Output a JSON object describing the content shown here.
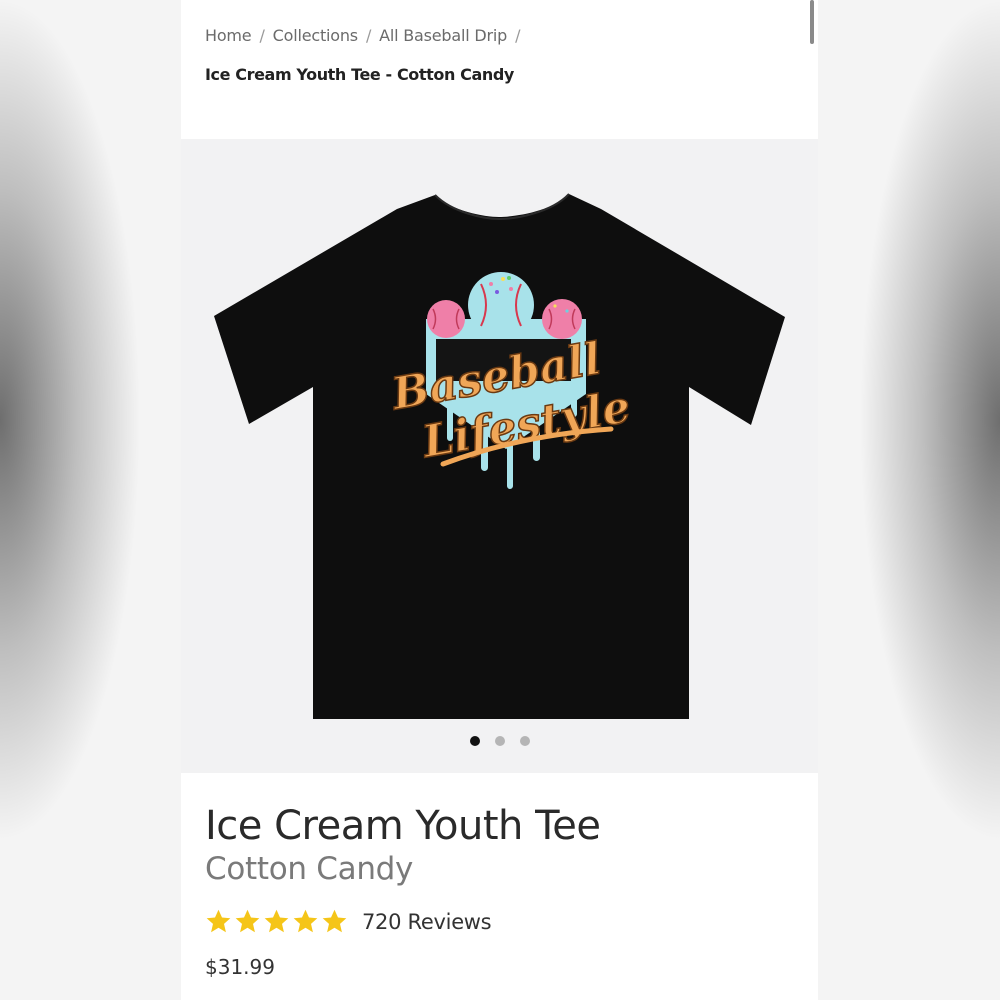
{
  "breadcrumb": {
    "items": [
      "Home",
      "Collections",
      "All Baseball Drip"
    ],
    "separator": "/",
    "current": "Ice Cream Youth Tee - Cotton Candy"
  },
  "gallery": {
    "print_text": [
      "Baseball",
      "Lifestyle"
    ],
    "slide_count": 3,
    "active_slide": 1
  },
  "product": {
    "title": "Ice Cream Youth Tee",
    "variant": "Cotton Candy",
    "rating": 5,
    "reviews_label": "720 Reviews",
    "price": "$31.99"
  },
  "colors": {
    "star": "#f5c518",
    "shirt": "#0e0e0e",
    "lettering": "#f0a657",
    "icecream_blue": "#a8e2ea",
    "icecream_pink": "#ef7fa8"
  }
}
